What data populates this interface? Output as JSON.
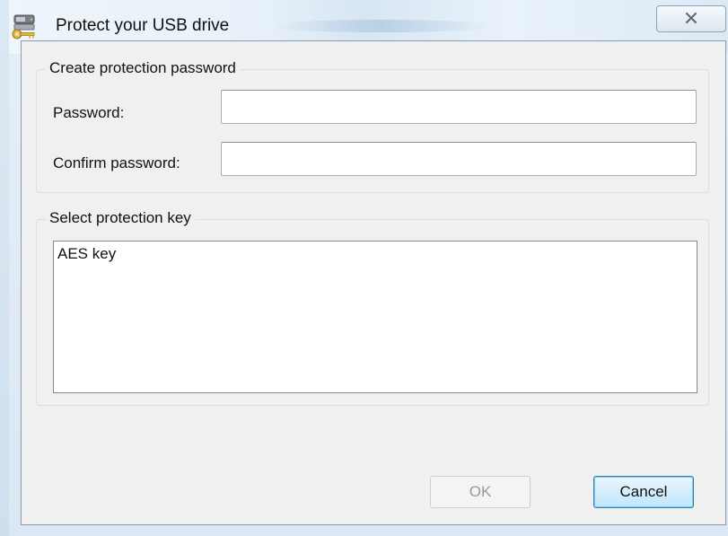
{
  "window": {
    "title": "Protect your USB drive",
    "icon": "usb-key-icon",
    "close_icon": "close-icon"
  },
  "password_group": {
    "label": "Create protection password",
    "password_label": "Password:",
    "password_value": "",
    "confirm_label": "Confirm password:",
    "confirm_value": ""
  },
  "key_group": {
    "label": "Select protection key",
    "items": [
      "AES key"
    ]
  },
  "buttons": {
    "ok_label": "OK",
    "ok_enabled": false,
    "cancel_label": "Cancel"
  },
  "colors": {
    "accent": "#3c7fb1",
    "dialog_bg": "#f0f0f0"
  }
}
